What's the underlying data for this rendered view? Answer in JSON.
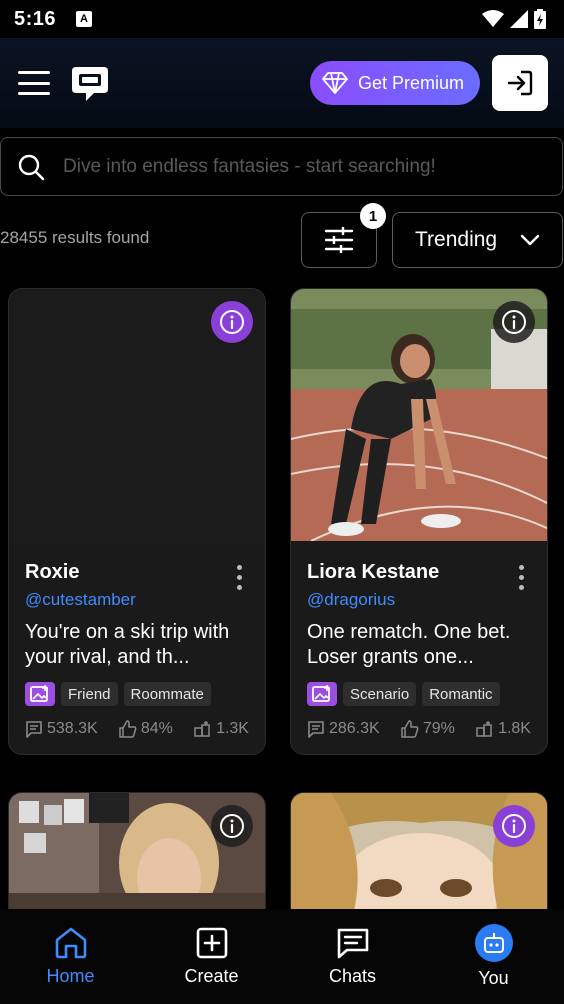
{
  "status": {
    "time": "5:16",
    "notif_letter": "A"
  },
  "header": {
    "premium_label": "Get Premium"
  },
  "search": {
    "placeholder": "Dive into endless fantasies - start searching!"
  },
  "results": {
    "count_text": "28455 results found",
    "filter_badge": "1",
    "sort_label": "Trending"
  },
  "cards": [
    {
      "name": "Roxie",
      "handle": "@cutestamber",
      "description": "You're on a ski trip with your rival, and th...",
      "tags": [
        "Friend",
        "Roommate"
      ],
      "messages": "538.3K",
      "likes": "84%",
      "remixes": "1.3K"
    },
    {
      "name": "Liora Kestane",
      "handle": "@dragorius",
      "description": "One rematch. One bet. Loser grants one...",
      "tags": [
        "Scenario",
        "Romantic"
      ],
      "messages": "286.3K",
      "likes": "79%",
      "remixes": "1.8K"
    }
  ],
  "nav": {
    "home": "Home",
    "create": "Create",
    "chats": "Chats",
    "you": "You"
  },
  "colors": {
    "accent": "#3f8cff",
    "premium": "#8a4dff",
    "tag_purple": "#9b4fe0"
  }
}
